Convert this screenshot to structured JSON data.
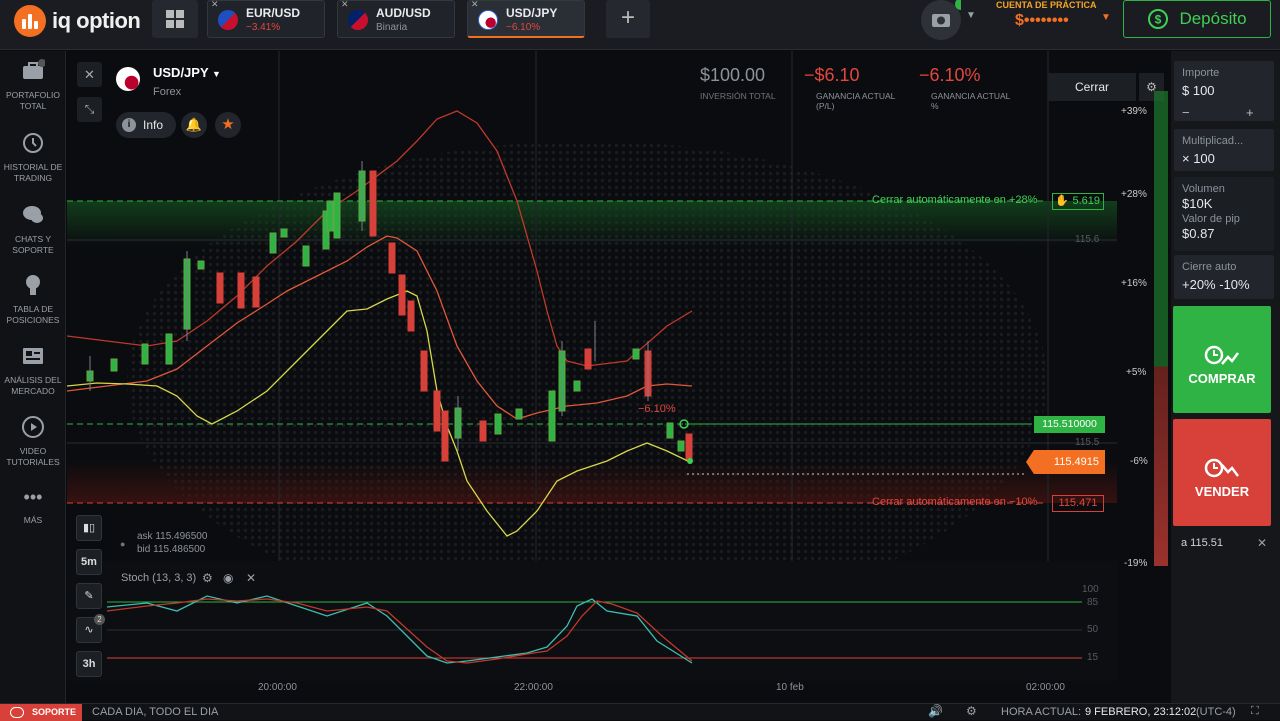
{
  "app": {
    "logo_text": "iq option"
  },
  "tabs": [
    {
      "name": "EUR/USD",
      "sub": "−3.41%",
      "sub_color": "#e2473f"
    },
    {
      "name": "AUD/USD",
      "sub": "Binaria",
      "sub_color": "#8d939b"
    },
    {
      "name": "USD/JPY",
      "sub": "−6.10%",
      "sub_color": "#e2473f"
    }
  ],
  "account": {
    "practice_label": "CUENTA DE PRÁCTICA",
    "balance": "$••••••••",
    "deposit_label": "Depósito"
  },
  "nav": [
    {
      "label": "PORTAFOLIO TOTAL",
      "badge": "2",
      "icon": "briefcase-icon"
    },
    {
      "label": "HISTORIAL DE TRADING",
      "icon": "history-icon"
    },
    {
      "label": "CHATS Y SOPORTE",
      "icon": "chat-icon"
    },
    {
      "label": "TABLA DE POSICIONES",
      "icon": "trophy-icon"
    },
    {
      "label": "ANÁLISIS DEL MERCADO",
      "icon": "newspaper-icon"
    },
    {
      "label": "VIDEO TUTORIALES",
      "icon": "play-icon"
    },
    {
      "label": "MÁS",
      "icon": "more-icon"
    }
  ],
  "asset": {
    "name": "USD/JPY",
    "type": "Forex",
    "info_label": "Info"
  },
  "stats": {
    "investment": "$100.00",
    "investment_label": "INVERSIÓN TOTAL",
    "profit": "−$6.10",
    "profit_label": "GANANCIA ACTUAL (P/L)",
    "profit_pct": "−6.10%",
    "profit_pct_label": "GANANCIA ACTUAL %"
  },
  "close_label": "Cerrar",
  "chart": {
    "take_profit_label": "Cerrar automáticamente en +28%",
    "take_profit_value": "5.619",
    "stop_loss_label": "Cerrar automáticamente en −10%",
    "stop_loss_value": "115.471",
    "entry_price": "115.510000",
    "current_price": "115.4915",
    "trade_pct": "−6.10%",
    "ask": "ask 115.496500",
    "bid": "bid 115.486500",
    "level_115_6": "115.6",
    "level_115_5": "115.5",
    "pct_ticks": [
      "+39%",
      "+28%",
      "+16%",
      "+5%",
      "-6%",
      "-19%"
    ],
    "time_ticks": [
      "20:00:00",
      "22:00:00",
      "10 feb",
      "02:00:00"
    ],
    "indicator_label": "Stoch (13, 3, 3)",
    "stoch_ticks": [
      "100",
      "85",
      "50",
      "15"
    ],
    "timeframe": "5m",
    "period": "3h",
    "indicator_badge": "2"
  },
  "chart_data": {
    "type": "candlestick",
    "series": [
      {
        "name": "USD/JPY",
        "close": [
          115.45,
          115.47,
          115.52,
          115.6,
          115.58,
          115.63,
          115.7,
          115.62,
          115.5,
          115.44,
          115.38,
          115.42,
          115.48,
          115.47,
          115.45,
          115.49
        ]
      }
    ],
    "indicators": [
      "Bollinger",
      "Stoch (13, 3, 3)"
    ]
  },
  "panel": {
    "amount_label": "Importe",
    "amount": "$ 100",
    "minus": "−",
    "plus": "+",
    "mult_label": "Multiplicad...",
    "mult": "× 100",
    "volume_label": "Volumen",
    "volume": "$10K",
    "pip_label": "Valor de pip",
    "pip": "$0.87",
    "auto_label": "Cierre auto",
    "auto": "+20% -10%",
    "buy_label": "COMPRAR",
    "sell_label": "VENDER",
    "price_at": "a 115.51"
  },
  "footer": {
    "support": "SOPORTE",
    "slogan": "CADA DIA, TODO EL DIA",
    "time_label": "HORA ACTUAL:",
    "time_value": "9 FEBRERO, 23:12:02",
    "tz": "(UTC-4)"
  }
}
